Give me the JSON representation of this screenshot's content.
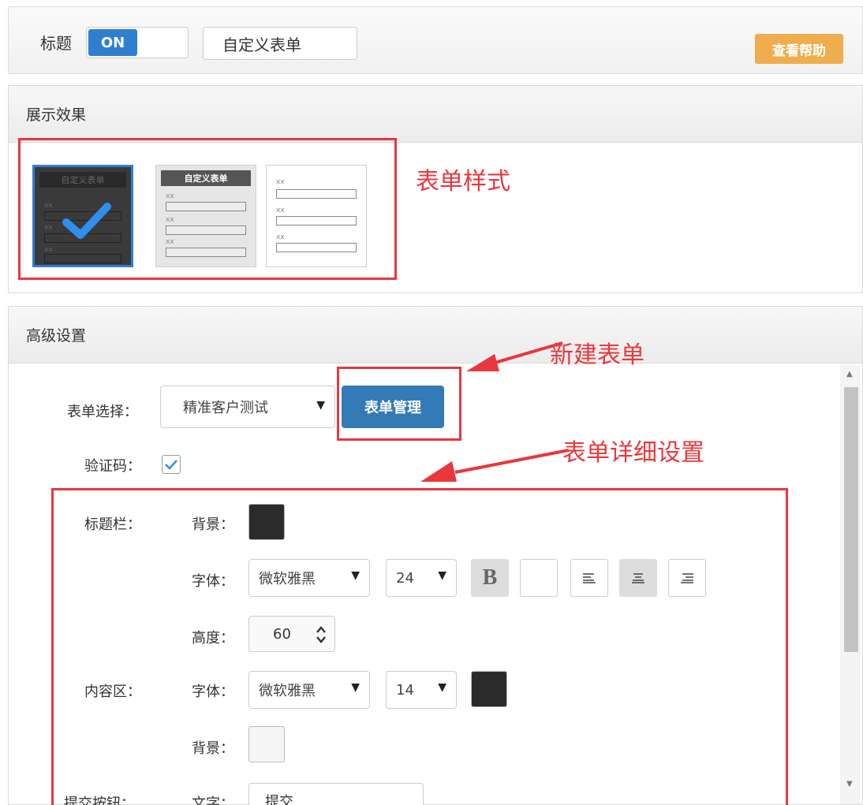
{
  "topbar": {
    "label": "标题",
    "toggle_on": "ON",
    "title_value": "自定义表单",
    "help_label": "查看帮助"
  },
  "display": {
    "header": "展示效果",
    "thumbs": [
      {
        "bar_text": "自定义表单",
        "tag": "xx",
        "selected": true
      },
      {
        "bar_text": "自定义表单",
        "tag": "xx",
        "selected": false
      },
      {
        "bar_text": "",
        "tag": "xx",
        "selected": false
      }
    ],
    "annotation": "表单样式"
  },
  "advanced": {
    "header": "高级设置",
    "annotation_new": "新建表单",
    "annotation_detail": "表单详细设置",
    "form_select_label": "表单选择：",
    "form_select_value": "精准客户测试",
    "manage_button": "表单管理",
    "captcha_label": "验证码：",
    "captcha_checked": true,
    "titlebar_label": "标题栏：",
    "titlebar_bg_label": "背景：",
    "titlebar_bg_color": "#2b2b2b",
    "titlebar_font_label": "字体：",
    "titlebar_font_value": "微软雅黑",
    "titlebar_size_value": "24",
    "bold_label": "B",
    "height_label": "高度：",
    "height_value": "60",
    "content_label": "内容区：",
    "content_font_label": "字体：",
    "content_font_value": "微软雅黑",
    "content_size_value": "14",
    "content_font_color": "#2b2b2b",
    "content_bg_label": "背景：",
    "content_bg_color": "#f5f5f5",
    "submit_label": "提交按钮：",
    "submit_text_label": "文字：",
    "submit_text_value": "提交"
  },
  "colors": {
    "accent": "#337ab7",
    "toggle_on": "#2f7fcf",
    "help": "#f0ad4e",
    "annotation_red": "#e8383d"
  }
}
